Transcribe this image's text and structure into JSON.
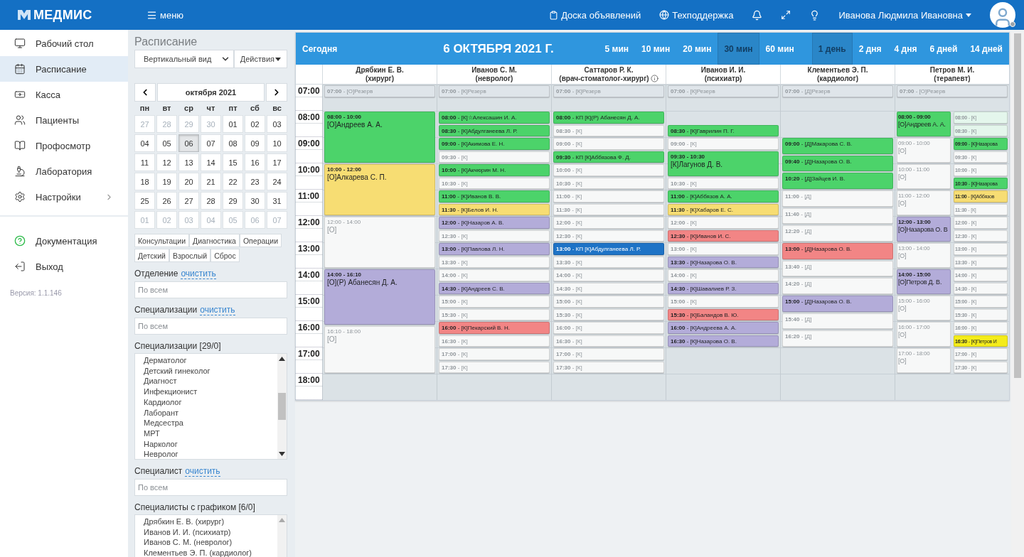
{
  "header": {
    "logo": "МЕДМИС",
    "menu": "меню",
    "board_link": "Доска объявлений",
    "support_link": "Техподдержка",
    "user_name": "Иванова Людмила Ивановна"
  },
  "sidebar": {
    "items": [
      {
        "label": "Рабочий стол",
        "selected": false,
        "has_submenu": false
      },
      {
        "label": "Расписание",
        "selected": true,
        "has_submenu": false
      },
      {
        "label": "Касса",
        "selected": false,
        "has_submenu": false
      },
      {
        "label": "Пациенты",
        "selected": false,
        "has_submenu": false
      },
      {
        "label": "Профосмотр",
        "selected": false,
        "has_submenu": false
      },
      {
        "label": "Лаборатория",
        "selected": false,
        "has_submenu": false
      },
      {
        "label": "Настройки",
        "selected": false,
        "has_submenu": true
      }
    ],
    "bottom_items": [
      "Документация",
      "Выход"
    ],
    "version": "Версия: 1.1.146"
  },
  "filter_panel": {
    "title": "Расписание",
    "view_select": "Вертикальный вид",
    "actions_button": "Действия",
    "calendar": {
      "month": "октября 2021",
      "weekdays": [
        "пн",
        "вт",
        "ср",
        "чт",
        "пт",
        "сб",
        "вс"
      ],
      "days": [
        {
          "day": "27",
          "outside": true,
          "selected": false
        },
        {
          "day": "28",
          "outside": true,
          "selected": false
        },
        {
          "day": "29",
          "outside": true,
          "selected": false
        },
        {
          "day": "30",
          "outside": true,
          "selected": false
        },
        {
          "day": "01",
          "outside": false,
          "selected": false
        },
        {
          "day": "02",
          "outside": false,
          "selected": false
        },
        {
          "day": "03",
          "outside": false,
          "selected": false
        },
        {
          "day": "04",
          "outside": false,
          "selected": false
        },
        {
          "day": "05",
          "outside": false,
          "selected": false
        },
        {
          "day": "06",
          "outside": false,
          "selected": true
        },
        {
          "day": "07",
          "outside": false,
          "selected": false
        },
        {
          "day": "08",
          "outside": false,
          "selected": false
        },
        {
          "day": "09",
          "outside": false,
          "selected": false
        },
        {
          "day": "10",
          "outside": false,
          "selected": false
        },
        {
          "day": "11",
          "outside": false,
          "selected": false
        },
        {
          "day": "12",
          "outside": false,
          "selected": false
        },
        {
          "day": "13",
          "outside": false,
          "selected": false
        },
        {
          "day": "14",
          "outside": false,
          "selected": false
        },
        {
          "day": "15",
          "outside": false,
          "selected": false
        },
        {
          "day": "16",
          "outside": false,
          "selected": false
        },
        {
          "day": "17",
          "outside": false,
          "selected": false
        },
        {
          "day": "18",
          "outside": false,
          "selected": false
        },
        {
          "day": "19",
          "outside": false,
          "selected": false
        },
        {
          "day": "20",
          "outside": false,
          "selected": false
        },
        {
          "day": "21",
          "outside": false,
          "selected": false
        },
        {
          "day": "22",
          "outside": false,
          "selected": false
        },
        {
          "day": "23",
          "outside": false,
          "selected": false
        },
        {
          "day": "24",
          "outside": false,
          "selected": false
        },
        {
          "day": "25",
          "outside": false,
          "selected": false
        },
        {
          "day": "26",
          "outside": false,
          "selected": false
        },
        {
          "day": "27",
          "outside": false,
          "selected": false
        },
        {
          "day": "28",
          "outside": false,
          "selected": false
        },
        {
          "day": "29",
          "outside": false,
          "selected": false
        },
        {
          "day": "30",
          "outside": false,
          "selected": false
        },
        {
          "day": "31",
          "outside": false,
          "selected": false
        },
        {
          "day": "01",
          "outside": true,
          "selected": false
        },
        {
          "day": "02",
          "outside": true,
          "selected": false
        },
        {
          "day": "03",
          "outside": true,
          "selected": false
        },
        {
          "day": "04",
          "outside": true,
          "selected": false
        },
        {
          "day": "05",
          "outside": true,
          "selected": false
        },
        {
          "day": "06",
          "outside": true,
          "selected": false
        },
        {
          "day": "07",
          "outside": true,
          "selected": false
        }
      ]
    },
    "type_button_rows": [
      {
        "buttons": [
          "Консультации",
          "Диагностика",
          "Операции"
        ]
      },
      {
        "buttons": [
          "Детский",
          "Взрослый",
          "Сброс"
        ]
      }
    ],
    "filters": [
      {
        "kind": "field",
        "label": "Отделение",
        "clear_link": "очистить",
        "placeholder": "По всем"
      },
      {
        "kind": "field",
        "label": "Специализации",
        "clear_link": "очистить",
        "placeholder": "По всем"
      },
      {
        "kind": "list",
        "label": "Специализации [29/0]",
        "items": [
          "Дерматолог",
          "Детский гинеколог",
          "Диагност",
          "Инфекционист",
          "Кардиолог",
          "Лаборант",
          "Медсестра",
          "МРТ",
          "Нарколог",
          "Невролог"
        ]
      },
      {
        "kind": "field",
        "label": "Специалист",
        "clear_link": "очистить",
        "placeholder": "По всем"
      },
      {
        "kind": "list",
        "label": "Специалисты с графиком [6/0]",
        "items": [
          "Дрябкин Е. В. (хирург)",
          "Иванов И. И. (психиатр)",
          "Иванов С. М. (невролог)",
          "Клементьев Э. П. (кардиолог)"
        ]
      }
    ]
  },
  "schedule": {
    "today_button": "Сегодня",
    "date": "6 ОКТЯБРЯ 2021 Г.",
    "intervals": [
      {
        "label": "5 мин",
        "selected": false
      },
      {
        "label": "10 мин",
        "selected": false
      },
      {
        "label": "20 мин",
        "selected": false
      },
      {
        "label": "30 мин",
        "selected": true
      },
      {
        "label": "60 мин",
        "selected": false
      }
    ],
    "ranges": [
      {
        "label": "1 день",
        "selected": true
      },
      {
        "label": "2 дня",
        "selected": false
      },
      {
        "label": "4 дня",
        "selected": false
      },
      {
        "label": "6 дней",
        "selected": false
      },
      {
        "label": "14 дней",
        "selected": false
      }
    ],
    "hours": [
      "07:00",
      "08:00",
      "09:00",
      "10:00",
      "11:00",
      "12:00",
      "13:00",
      "14:00",
      "15:00",
      "16:00",
      "17:00",
      "18:00"
    ],
    "doctors": [
      {
        "name": "Дрябкин Е. В.",
        "specialty": "(хирург)",
        "info": false,
        "tracks": [
          {
            "slots": [
              {
                "kind": "reserve",
                "booked": false,
                "color": "#dfe5ea",
                "text": "**07:00** - [О]Резерв"
              },
              {
                "kind": "block",
                "booked": true,
                "color": "#4cd36a",
                "time": "08:00 - 10:00",
                "patient": "[О]Андреев А. А."
              },
              {
                "kind": "block",
                "booked": true,
                "color": "#f7dd73",
                "time": "10:00 - 12:00",
                "patient": "[О]Алкарева С. П."
              },
              {
                "kind": "block",
                "booked": false,
                "color": "#f7f8f8",
                "time": "12:00 - 14:00",
                "patient": "[О]"
              },
              {
                "kind": "block",
                "booked": true,
                "color": "#b3acd9",
                "time": "14:00 - 16:10",
                "patient": "[О](Р) Абанесян Д. А."
              },
              {
                "kind": "block",
                "booked": false,
                "color": "#f7f8f8",
                "time": "16:10 - 18:00",
                "patient": "[О]"
              }
            ]
          }
        ]
      },
      {
        "name": "Иванов С. М.",
        "specialty": "(невролог)",
        "info": false,
        "tracks": [
          {
            "slots": [
              {
                "kind": "reserve",
                "booked": false,
                "color": "#dfe5ea",
                "text": "**07:00** - [К]Резерв"
              },
              {
                "kind": "line",
                "booked": true,
                "color": "#4cd36a",
                "text": "**08:00** - [К]☆Алексашин И. А."
              },
              {
                "kind": "line",
                "booked": true,
                "color": "#4cd36a",
                "text": "**08:30** - [К]Абдулганеева Л. Р."
              },
              {
                "kind": "line",
                "booked": true,
                "color": "#4cd36a",
                "text": "**09:00** - [К]Акимова Е. Н."
              },
              {
                "kind": "line",
                "booked": false,
                "color": "#f7f8f8",
                "text": "**09:30** - [К]"
              },
              {
                "kind": "line",
                "booked": true,
                "color": "#4cd36a",
                "text": "**10:00** - [К]Акчюрин М. Н."
              },
              {
                "kind": "line",
                "booked": false,
                "color": "#f7f8f8",
                "text": "**10:30** - [К]"
              },
              {
                "kind": "line",
                "booked": true,
                "color": "#4cd36a",
                "text": "**11:00** - [К]Иванов В. В."
              },
              {
                "kind": "line",
                "booked": true,
                "color": "#f7dd73",
                "text": "**11:30** - [К]Белов И. Н."
              },
              {
                "kind": "line",
                "booked": true,
                "color": "#b3acd9",
                "text": "**12:00** - [К]Назаров А. В."
              },
              {
                "kind": "line",
                "booked": false,
                "color": "#f7f8f8",
                "text": "**12:30** - [К]"
              },
              {
                "kind": "line",
                "booked": true,
                "color": "#b3acd9",
                "text": "**13:00** - [К]Павлова Л. Н."
              },
              {
                "kind": "line",
                "booked": false,
                "color": "#f7f8f8",
                "text": "**13:30** - [К]"
              },
              {
                "kind": "line",
                "booked": false,
                "color": "#f7f8f8",
                "text": "**14:00** - [К]"
              },
              {
                "kind": "line",
                "booked": true,
                "color": "#b3acd9",
                "text": "**14:30** - [К]Андреев С. В."
              },
              {
                "kind": "line",
                "booked": false,
                "color": "#f7f8f8",
                "text": "**15:00** - [К]"
              },
              {
                "kind": "line",
                "booked": false,
                "color": "#f7f8f8",
                "text": "**15:30** - [К]"
              },
              {
                "kind": "line",
                "booked": true,
                "color": "#f28585",
                "text": "**16:00** - [К]Пекарский В. Н."
              },
              {
                "kind": "line",
                "booked": false,
                "color": "#f7f8f8",
                "text": "**16:30** - [К]"
              },
              {
                "kind": "line",
                "booked": false,
                "color": "#f7f8f8",
                "text": "**17:00** - [К]"
              },
              {
                "kind": "line",
                "booked": false,
                "color": "#f7f8f8",
                "text": "**17:30** - [К]"
              }
            ]
          }
        ]
      },
      {
        "name": "Саттаров Р. К.",
        "specialty": "(врач-стоматолог-хирург)",
        "info": true,
        "tracks": [
          {
            "slots": [
              {
                "kind": "reserve",
                "booked": false,
                "color": "#dfe5ea",
                "text": "**07:00** - [К]Резерв"
              },
              {
                "kind": "line",
                "booked": true,
                "color": "#4cd36a",
                "text": "**08:00** - КП [К](Р) Абанесян Д. А."
              },
              {
                "kind": "line",
                "booked": false,
                "color": "#f7f8f8",
                "text": "**08:30** - [К]"
              },
              {
                "kind": "line",
                "booked": false,
                "color": "#f7f8f8",
                "text": "**09:00** - [К]"
              },
              {
                "kind": "line",
                "booked": true,
                "color": "#4cd36a",
                "text": "**09:30** - КП [К]Аббязова Ф. Д."
              },
              {
                "kind": "line",
                "booked": false,
                "color": "#f7f8f8",
                "text": "**10:00** - [К]"
              },
              {
                "kind": "line",
                "booked": false,
                "color": "#f7f8f8",
                "text": "**10:30** - [К]"
              },
              {
                "kind": "line",
                "booked": false,
                "color": "#f7f8f8",
                "text": "**11:00** - [К]"
              },
              {
                "kind": "line",
                "booked": false,
                "color": "#f7f8f8",
                "text": "**11:30** - [К]"
              },
              {
                "kind": "line",
                "booked": false,
                "color": "#f7f8f8",
                "text": "**12:00** - [К]"
              },
              {
                "kind": "line",
                "booked": false,
                "color": "#f7f8f8",
                "text": "**12:30** - [К]"
              },
              {
                "kind": "line",
                "booked": true,
                "color": "#1e73c6",
                "text": "**13:00** - КП [К]Абдулганеева Л. Р."
              },
              {
                "kind": "line",
                "booked": false,
                "color": "#f7f8f8",
                "text": "**13:30** - [К]"
              },
              {
                "kind": "line",
                "booked": false,
                "color": "#f7f8f8",
                "text": "**14:00** - [К]"
              },
              {
                "kind": "line",
                "booked": false,
                "color": "#f7f8f8",
                "text": "**14:30** - [К]"
              },
              {
                "kind": "line",
                "booked": false,
                "color": "#f7f8f8",
                "text": "**15:00** - [К]"
              },
              {
                "kind": "line",
                "booked": false,
                "color": "#f7f8f8",
                "text": "**15:30** - [К]"
              },
              {
                "kind": "line",
                "booked": false,
                "color": "#f7f8f8",
                "text": "**16:00** - [К]"
              },
              {
                "kind": "line",
                "booked": false,
                "color": "#f7f8f8",
                "text": "**16:30** - [К]"
              },
              {
                "kind": "line",
                "booked": false,
                "color": "#f7f8f8",
                "text": "**17:00** - [К]"
              },
              {
                "kind": "line",
                "booked": false,
                "color": "#f7f8f8",
                "text": "**17:30** - [К]"
              }
            ]
          }
        ]
      },
      {
        "name": "Иванов И. И.",
        "specialty": "(психиатр)",
        "info": false,
        "tracks": [
          {
            "slots": [
              {
                "kind": "reserve",
                "booked": false,
                "color": "#dfe5ea",
                "text": "**07:00** - [К]Резерв"
              },
              {
                "kind": "line",
                "booked": true,
                "color": "#4cd36a",
                "text": "**08:30** - [К]Гаврилин П. Г."
              },
              {
                "kind": "line",
                "booked": false,
                "color": "#f7f8f8",
                "text": "**09:00** - [К]"
              },
              {
                "kind": "block",
                "booked": true,
                "color": "#4cd36a",
                "time": "09:30 - 10:30",
                "patient": "[К]Лагунов Д. В."
              },
              {
                "kind": "line",
                "booked": false,
                "color": "#f7f8f8",
                "text": "**10:30** - [К]"
              },
              {
                "kind": "line",
                "booked": true,
                "color": "#4cd36a",
                "text": "**11:00** - [К]Аббязов А. А."
              },
              {
                "kind": "line",
                "booked": true,
                "color": "#f7dd73",
                "text": "**11:30** - [К]Хабаров Е. С."
              },
              {
                "kind": "line",
                "booked": false,
                "color": "#f7f8f8",
                "text": "**12:00** - [К]"
              },
              {
                "kind": "line",
                "booked": true,
                "color": "#f28585",
                "text": "**12:30** - [К]Иванов И. С."
              },
              {
                "kind": "line",
                "booked": false,
                "color": "#f7f8f8",
                "text": "**13:00** - [К]"
              },
              {
                "kind": "line",
                "booked": true,
                "color": "#b3acd9",
                "text": "**13:30** - [К]Назарова О. В."
              },
              {
                "kind": "line",
                "booked": false,
                "color": "#f7f8f8",
                "text": "**14:00** - [К]"
              },
              {
                "kind": "line",
                "booked": true,
                "color": "#b3acd9",
                "text": "**14:30** - [К]Шавалиев Р. З."
              },
              {
                "kind": "line",
                "booked": false,
                "color": "#f7f8f8",
                "text": "**15:00** - [К]"
              },
              {
                "kind": "line",
                "booked": true,
                "color": "#f28585",
                "text": "**15:30** - [К]Баландов В. Ю."
              },
              {
                "kind": "line",
                "booked": true,
                "color": "#b3acd9",
                "text": "**16:00** - [К]Андреева А. А."
              },
              {
                "kind": "line",
                "booked": true,
                "color": "#b3acd9",
                "text": "**16:30** - [К]Назарова О. В."
              }
            ]
          }
        ]
      },
      {
        "name": "Клементьев Э. П.",
        "specialty": "(кардиолог)",
        "info": false,
        "tracks": [
          {
            "slots": [
              {
                "kind": "reserve",
                "booked": false,
                "color": "#dfe5ea",
                "text": "**07:00** - [Д]Резерв"
              },
              {
                "kind": "line",
                "booked": true,
                "color": "#4cd36a",
                "text": "**09:00** - [Д]Макарова С. В."
              },
              {
                "kind": "line",
                "booked": true,
                "color": "#4cd36a",
                "text": "**09:40** - [Д]Назарова О. В."
              },
              {
                "kind": "line",
                "booked": true,
                "color": "#4cd36a",
                "text": "**10:20** - [Д]Зайцев И. В."
              },
              {
                "kind": "line",
                "booked": false,
                "color": "#f7f8f8",
                "text": "**11:00** - [Д]"
              },
              {
                "kind": "line",
                "booked": false,
                "color": "#f7f8f8",
                "text": "**11:40** - [Д]"
              },
              {
                "kind": "line",
                "booked": false,
                "color": "#f7f8f8",
                "text": "**12:20** - [Д]"
              },
              {
                "kind": "line",
                "booked": true,
                "color": "#f28585",
                "text": "**13:00** - [Д]Назарова О. В."
              },
              {
                "kind": "line",
                "booked": false,
                "color": "#f7f8f8",
                "text": "**13:40** - [Д]"
              },
              {
                "kind": "line",
                "booked": false,
                "color": "#f7f8f8",
                "text": "**14:20** - [Д]"
              },
              {
                "kind": "line",
                "booked": true,
                "color": "#b3acd9",
                "text": "**15:00** - [Д]Назарова О. В."
              },
              {
                "kind": "line",
                "booked": false,
                "color": "#f7f8f8",
                "text": "**15:40** - [Д]"
              },
              {
                "kind": "line",
                "booked": false,
                "color": "#f7f8f8",
                "text": "**16:20** - [Д]"
              }
            ]
          }
        ]
      },
      {
        "name": "Петров М. И.",
        "specialty": "(терапевт)",
        "info": false,
        "tracks": [
          {
            "slots": [
              {
                "kind": "reserve",
                "booked": false,
                "color": "#dfe5ea",
                "text": "**07:00** - [О]Резерв"
              },
              {
                "kind": "block",
                "booked": true,
                "color": "#4cd36a",
                "time": "08:00 - 09:00",
                "patient": "[О]Андреев А. А."
              },
              {
                "kind": "block",
                "booked": false,
                "color": "#f7f8f8",
                "time": "09:00 - 10:00",
                "patient": "[О]"
              },
              {
                "kind": "block",
                "booked": false,
                "color": "#f7f8f8",
                "time": "10:00 - 11:00",
                "patient": "[О]"
              },
              {
                "kind": "block",
                "booked": false,
                "color": "#f7f8f8",
                "time": "11:00 - 12:00",
                "patient": "[О]"
              },
              {
                "kind": "block",
                "booked": true,
                "color": "#b3acd9",
                "time": "12:00 - 13:00",
                "patient": "[О]Назарова О. В"
              },
              {
                "kind": "block",
                "booked": false,
                "color": "#f7f8f8",
                "time": "13:00 - 14:00",
                "patient": "[О]"
              },
              {
                "kind": "block",
                "booked": true,
                "color": "#b3acd9",
                "time": "14:00 - 15:00",
                "patient": "[О]Петров Д. В."
              },
              {
                "kind": "block",
                "booked": false,
                "color": "#f7f8f8",
                "time": "15:00 - 16:00",
                "patient": "[О]"
              },
              {
                "kind": "block",
                "booked": false,
                "color": "#f7f8f8",
                "time": "16:00 - 17:00",
                "patient": "[О]"
              },
              {
                "kind": "block",
                "booked": false,
                "color": "#f7f8f8",
                "time": "17:00 - 18:00",
                "patient": "[О]"
              }
            ]
          },
          {
            "slots": [
              {
                "kind": "line",
                "booked": false,
                "color": "#e4f6ec",
                "text": "**08:00** - [К]"
              },
              {
                "kind": "line",
                "booked": false,
                "color": "#e4f6ec",
                "text": "**08:30** - [К]"
              },
              {
                "kind": "line",
                "booked": true,
                "color": "#4cd36a",
                "text": "**09:00** - [К]Назарова"
              },
              {
                "kind": "line",
                "booked": false,
                "color": "#f7f8f8",
                "text": "**09:30** - [К]"
              },
              {
                "kind": "line",
                "booked": false,
                "color": "#f7f8f8",
                "text": "**10:00** - [К]"
              },
              {
                "kind": "line",
                "booked": true,
                "color": "#4cd36a",
                "text": "**10:30** - [К]Назарова"
              },
              {
                "kind": "line",
                "booked": true,
                "color": "#f7dd73",
                "text": "**11:00** - [К]Аббязов"
              },
              {
                "kind": "line",
                "booked": false,
                "color": "#f7f8f8",
                "text": "**11:30** - [К]"
              },
              {
                "kind": "line",
                "booked": false,
                "color": "#f7f8f8",
                "text": "**12:00** - [К]"
              },
              {
                "kind": "line",
                "booked": false,
                "color": "#f7f8f8",
                "text": "**12:30** - [К]"
              },
              {
                "kind": "line",
                "booked": false,
                "color": "#f7f8f8",
                "text": "**13:00** - [К]"
              },
              {
                "kind": "line",
                "booked": false,
                "color": "#f7f8f8",
                "text": "**13:30** - [К]"
              },
              {
                "kind": "line",
                "booked": false,
                "color": "#f7f8f8",
                "text": "**14:00** - [К]"
              },
              {
                "kind": "line",
                "booked": false,
                "color": "#f7f8f8",
                "text": "**14:30** - [К]"
              },
              {
                "kind": "line",
                "booked": false,
                "color": "#f7f8f8",
                "text": "**15:00** - [К]"
              },
              {
                "kind": "line",
                "booked": false,
                "color": "#f7f8f8",
                "text": "**15:30** - [К]"
              },
              {
                "kind": "line",
                "booked": false,
                "color": "#f7f8f8",
                "text": "**16:00** - [К]"
              },
              {
                "kind": "line",
                "booked": true,
                "color": "#f4ec1a",
                "text": "**16:30** - [К]Петров И"
              },
              {
                "kind": "line",
                "booked": false,
                "color": "#f7f8f8",
                "text": "**17:00** - [К]"
              },
              {
                "kind": "line",
                "booked": false,
                "color": "#f7f8f8",
                "text": "**17:30** - [К]"
              }
            ]
          }
        ]
      }
    ]
  }
}
